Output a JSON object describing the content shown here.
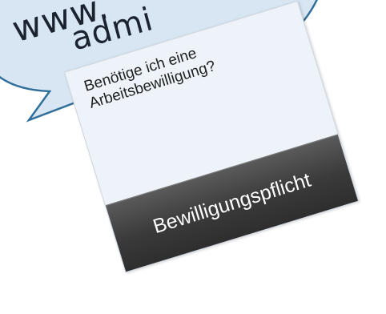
{
  "bubble": {
    "line_1": "www.",
    "line_2": "admi",
    "fill_color": "#d7e6f2",
    "stroke_color": "#2f6f9a"
  },
  "card": {
    "question": "Benötige ich eine Arbeitsbewilligung?",
    "button_label": "Bewilligungspflicht",
    "background_color": "#eef3f9",
    "button_color": "#3a3a3a"
  }
}
